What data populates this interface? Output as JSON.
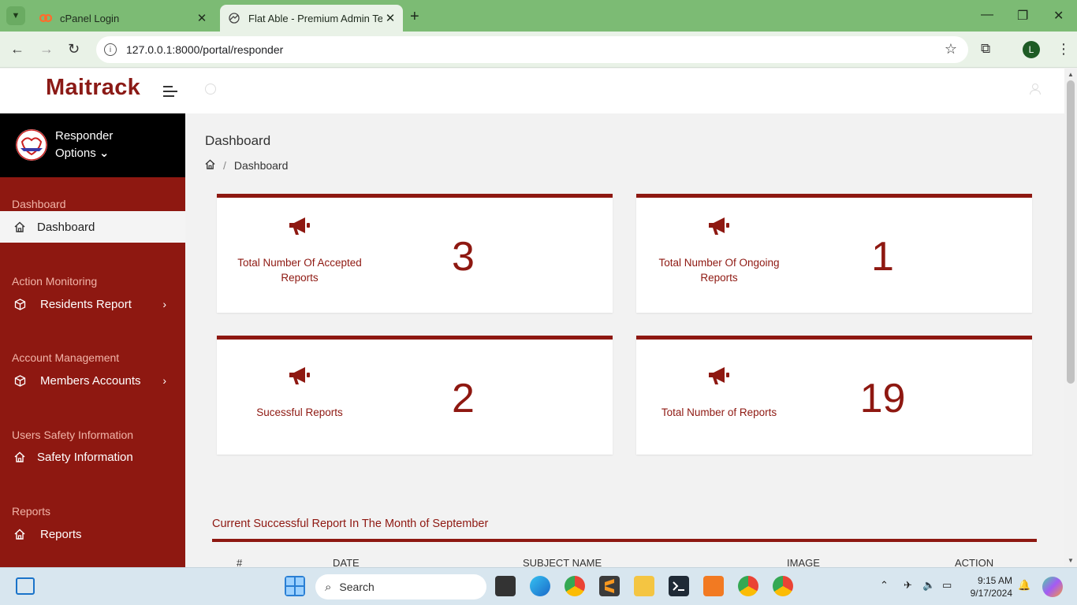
{
  "browser": {
    "tabs": [
      {
        "title": "cPanel Login",
        "active": false
      },
      {
        "title": "Flat Able - Premium Admin Tem",
        "active": true
      }
    ],
    "url": "127.0.0.1:8000/portal/responder",
    "profile_initial": "L"
  },
  "app": {
    "brand": "Maitrack",
    "profile": {
      "name": "Responder",
      "options_label": "Options"
    },
    "sidebar": {
      "sections": [
        {
          "label": "Dashboard",
          "items": [
            {
              "label": "Dashboard",
              "icon": "home-icon",
              "active": true,
              "has_children": false
            }
          ]
        },
        {
          "label": "Action Monitoring",
          "items": [
            {
              "label": "Residents Report",
              "icon": "box-icon",
              "active": false,
              "has_children": true
            }
          ]
        },
        {
          "label": "Account Management",
          "items": [
            {
              "label": "Members Accounts",
              "icon": "box-icon",
              "active": false,
              "has_children": true
            }
          ]
        },
        {
          "label": "Users Safety Information",
          "items": [
            {
              "label": "Safety Information",
              "icon": "home-icon",
              "active": false,
              "has_children": false
            }
          ]
        },
        {
          "label": "Reports",
          "items": [
            {
              "label": "Reports",
              "icon": "home-icon",
              "active": false,
              "has_children": false
            }
          ]
        }
      ]
    },
    "page_title": "Dashboard",
    "breadcrumb": [
      "Dashboard"
    ],
    "cards": [
      {
        "label": "Total Number Of Accepted Reports",
        "value": "3",
        "icon": "megaphone-icon"
      },
      {
        "label": "Total Number Of Ongoing Reports",
        "value": "1",
        "icon": "megaphone-icon"
      },
      {
        "label": "Sucessful Reports",
        "value": "2",
        "icon": "megaphone-icon"
      },
      {
        "label": "Total Number of Reports",
        "value": "19",
        "icon": "megaphone-icon"
      }
    ],
    "report_table": {
      "heading": "Current Successful Report In The Month of September",
      "columns": [
        "#",
        "DATE",
        "SUBJECT NAME",
        "IMAGE",
        "ACTION"
      ]
    },
    "colors": {
      "primary": "#8e1811",
      "sidebar_header": "#000000",
      "browser_chrome": "#7cbb74"
    }
  },
  "taskbar": {
    "search_placeholder": "Search",
    "time": "9:15 AM",
    "date": "9/17/2024"
  }
}
